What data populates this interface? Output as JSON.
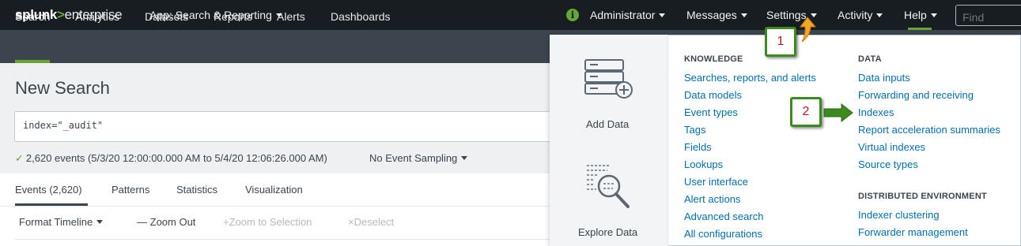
{
  "topbar": {
    "logo_main": "splunk",
    "logo_gt": ">",
    "logo_product": "enterprise",
    "app_menu": "App: Search & Reporting",
    "info_glyph": "i",
    "menus": [
      "Administrator",
      "Messages",
      "Settings",
      "Activity",
      "Help"
    ],
    "find_placeholder": "Find"
  },
  "navbar": {
    "items": [
      "Search",
      "Analytics",
      "Datasets",
      "Reports",
      "Alerts",
      "Dashboards"
    ],
    "active": "Search"
  },
  "search": {
    "page_title": "New Search",
    "query": "index=\"_audit\"",
    "check_glyph": "✓",
    "events_summary": "2,620 events (5/3/20 12:00:00.000 AM to 5/4/20 12:06:26.000 AM)",
    "sampling": "No Event Sampling"
  },
  "tabs": {
    "items": [
      "Events (2,620)",
      "Patterns",
      "Statistics",
      "Visualization"
    ],
    "active": "Events (2,620)"
  },
  "timeline_toolbar": {
    "format_timeline": "Format Timeline",
    "zoom_out": "Zoom Out",
    "zoom_selection": "Zoom to Selection",
    "deselect": "Deselect",
    "zoom_out_glyph": "—",
    "zoom_selection_glyph": "+",
    "deselect_glyph": "×"
  },
  "settings_menu": {
    "tiles": [
      "Add Data",
      "Explore Data"
    ],
    "knowledge": {
      "heading": "KNOWLEDGE",
      "links": [
        "Searches, reports, and alerts",
        "Data models",
        "Event types",
        "Tags",
        "Fields",
        "Lookups",
        "User interface",
        "Alert actions",
        "Advanced search",
        "All configurations"
      ]
    },
    "data": {
      "heading": "DATA",
      "links": [
        "Data inputs",
        "Forwarding and receiving",
        "Indexes",
        "Report acceleration summaries",
        "Virtual indexes",
        "Source types"
      ]
    },
    "distributed": {
      "heading": "DISTRIBUTED ENVIRONMENT",
      "links": [
        "Indexer clustering",
        "Forwarder management"
      ]
    }
  },
  "callouts": [
    "1",
    "2"
  ],
  "colors": {
    "topbar_bg": "#171d21",
    "navbar_bg": "#3c444d",
    "accent_green": "#65a637",
    "link_blue": "#006eaa",
    "callout_border": "#3a8a1e",
    "callout_text": "#c0191b",
    "arrow_orange": "#f5a623"
  }
}
